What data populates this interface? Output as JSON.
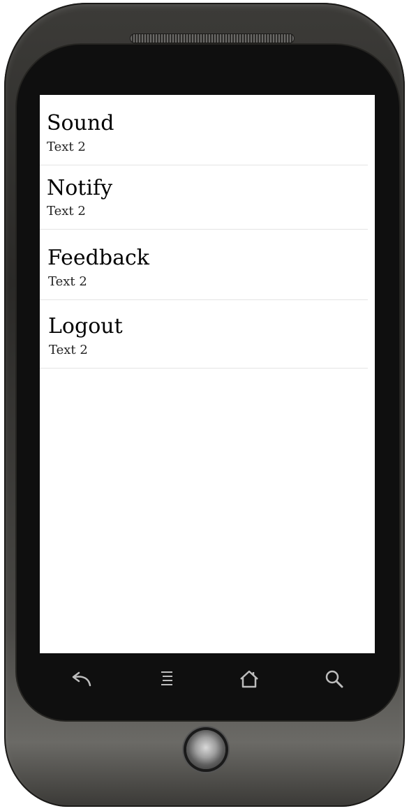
{
  "settings_list": {
    "items": [
      {
        "title": "Sound",
        "subtitle": "Text 2"
      },
      {
        "title": "Notify",
        "subtitle": "Text 2"
      },
      {
        "title": "Feedback",
        "subtitle": "Text 2"
      },
      {
        "title": "Logout",
        "subtitle": "Text 2"
      }
    ]
  },
  "nav_bar": {
    "icons": [
      "back-icon",
      "menu-icon",
      "home-icon",
      "search-icon"
    ]
  },
  "colors": {
    "screen_background": "#ffffff",
    "divider": "#e4e4e4",
    "bezel": "#0f0f0f",
    "nav_icon": "#bdbdbd"
  }
}
